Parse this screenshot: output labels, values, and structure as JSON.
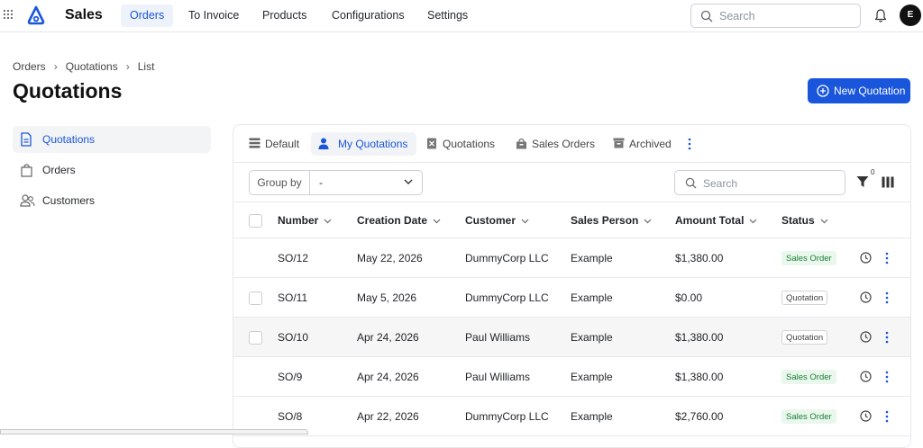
{
  "app": {
    "title": "Sales",
    "avatar_initial": "E"
  },
  "topnav": [
    {
      "label": "Orders",
      "active": true
    },
    {
      "label": "To Invoice",
      "active": false
    },
    {
      "label": "Products",
      "active": false
    },
    {
      "label": "Configurations",
      "active": false
    },
    {
      "label": "Settings",
      "active": false
    }
  ],
  "top_search": {
    "placeholder": "Search"
  },
  "breadcrumb": [
    "Orders",
    "Quotations",
    "List"
  ],
  "page_title": "Quotations",
  "new_button": "New Quotation",
  "sidebar": [
    {
      "label": "Quotations",
      "icon": "document-icon",
      "active": true
    },
    {
      "label": "Orders",
      "icon": "shopping-bag-icon",
      "active": false
    },
    {
      "label": "Customers",
      "icon": "users-icon",
      "active": false
    }
  ],
  "tabs": [
    {
      "label": "Default",
      "icon": "list-icon",
      "active": false
    },
    {
      "label": "My Quotations",
      "icon": "user-icon",
      "active": true
    },
    {
      "label": "Quotations",
      "icon": "file-x-icon",
      "active": false
    },
    {
      "label": "Sales Orders",
      "icon": "bag-icon",
      "active": false
    },
    {
      "label": "Archived",
      "icon": "archive-icon",
      "active": false
    }
  ],
  "toolbar": {
    "group_by_label": "Group by",
    "group_by_value": "-",
    "search_placeholder": "Search",
    "filter_count": "0"
  },
  "columns": [
    "Number",
    "Creation Date",
    "Customer",
    "Sales Person",
    "Amount Total",
    "Status"
  ],
  "rows": [
    {
      "number": "SO/12",
      "date": "May 22, 2026",
      "customer": "DummyCorp LLC",
      "salesperson": "Example",
      "amount": "$1,380.00",
      "status": "Sales Order",
      "checkbox": false
    },
    {
      "number": "SO/11",
      "date": "May 5, 2026",
      "customer": "DummyCorp LLC",
      "salesperson": "Example",
      "amount": "$0.00",
      "status": "Quotation",
      "checkbox": true
    },
    {
      "number": "SO/10",
      "date": "Apr 24, 2026",
      "customer": "Paul Williams",
      "salesperson": "Example",
      "amount": "$1,380.00",
      "status": "Quotation",
      "checkbox": true
    },
    {
      "number": "SO/9",
      "date": "Apr 24, 2026",
      "customer": "Paul Williams",
      "salesperson": "Example",
      "amount": "$1,380.00",
      "status": "Sales Order",
      "checkbox": false
    },
    {
      "number": "SO/8",
      "date": "Apr 22, 2026",
      "customer": "DummyCorp LLC",
      "salesperson": "Example",
      "amount": "$2,760.00",
      "status": "Sales Order",
      "checkbox": false
    }
  ],
  "colors": {
    "accent": "#1a56db",
    "order_badge": "#1a7f37"
  }
}
